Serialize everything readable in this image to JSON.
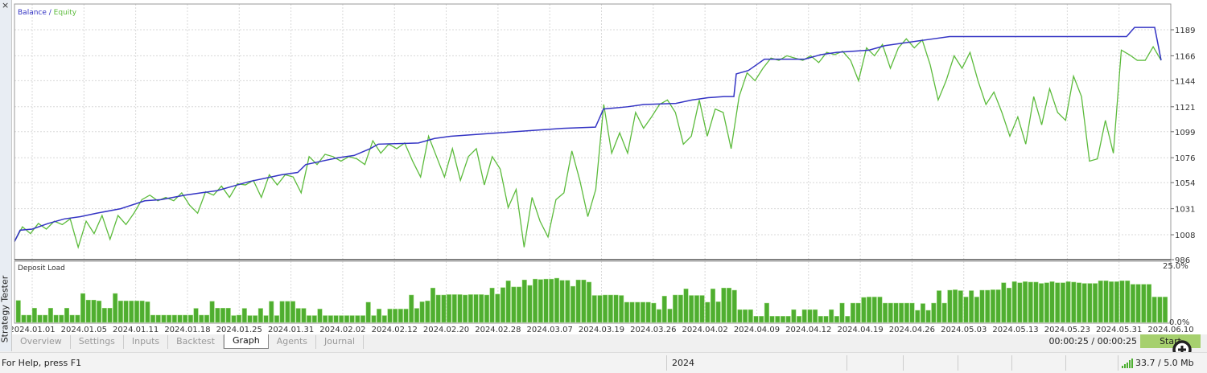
{
  "window": {
    "close_label": "×",
    "panel_title": "Strategy Tester"
  },
  "legend": {
    "balance": "Balance",
    "separator": " / ",
    "equity": "Equity"
  },
  "colors": {
    "balance": "#3434c4",
    "equity": "#5cbb3c",
    "bars": "#4fae30",
    "grid": "#d8d8d8"
  },
  "chart_data": [
    {
      "type": "line",
      "title": "Balance / Equity",
      "x_unit": "time index",
      "xlim": [
        0,
        142.5
      ],
      "ylim": [
        986,
        1200
      ],
      "y_ticks": [
        "1189",
        "1166",
        "1144",
        "1121",
        "1099",
        "1076",
        "1054",
        "1031",
        "1008",
        "986"
      ],
      "y_tick_values": [
        1189,
        1166,
        1144,
        1121,
        1099,
        1076,
        1054,
        1031,
        1008,
        986
      ],
      "grid": true,
      "series": [
        {
          "name": "Balance",
          "points": [
            [
              0,
              1002
            ],
            [
              0.7,
              1012
            ],
            [
              2.2,
              1013
            ],
            [
              4.2,
              1018
            ],
            [
              6.2,
              1022
            ],
            [
              8.2,
              1024
            ],
            [
              10.2,
              1027
            ],
            [
              13.2,
              1031
            ],
            [
              16.2,
              1038
            ],
            [
              18.2,
              1039
            ],
            [
              21.2,
              1043
            ],
            [
              23.2,
              1045
            ],
            [
              25.2,
              1047
            ],
            [
              27.2,
              1051
            ],
            [
              29.2,
              1055
            ],
            [
              31.2,
              1058
            ],
            [
              33.2,
              1061
            ],
            [
              35.2,
              1063
            ],
            [
              36.2,
              1070
            ],
            [
              38.2,
              1073
            ],
            [
              40.2,
              1076
            ],
            [
              42.2,
              1078
            ],
            [
              44.2,
              1084
            ],
            [
              45.2,
              1088
            ],
            [
              50.2,
              1089
            ],
            [
              52.2,
              1093
            ],
            [
              54.2,
              1095
            ],
            [
              68.2,
              1102
            ],
            [
              72.2,
              1103
            ],
            [
              73.2,
              1119
            ],
            [
              76.2,
              1121
            ],
            [
              78.2,
              1123
            ],
            [
              82.2,
              1124
            ],
            [
              84.2,
              1127
            ],
            [
              86.2,
              1129
            ],
            [
              88.2,
              1130
            ],
            [
              89.4,
              1130
            ],
            [
              89.7,
              1150
            ],
            [
              91.2,
              1153
            ],
            [
              92.2,
              1158
            ],
            [
              93.2,
              1163
            ],
            [
              98.2,
              1163
            ],
            [
              100.2,
              1167
            ],
            [
              102.2,
              1169
            ],
            [
              106.2,
              1171
            ],
            [
              108.2,
              1175
            ],
            [
              113.2,
              1180
            ],
            [
              116.2,
              1183
            ],
            [
              138.2,
              1183
            ],
            [
              139.2,
              1191
            ],
            [
              141.7,
              1191
            ],
            [
              142.5,
              1162
            ]
          ]
        },
        {
          "name": "Equity",
          "values": [
            1002,
            1015,
            1009,
            1018,
            1013,
            1020,
            1017,
            1022,
            997,
            1020,
            1009,
            1025,
            1004,
            1025,
            1017,
            1027,
            1039,
            1043,
            1038,
            1041,
            1038,
            1045,
            1034,
            1027,
            1046,
            1043,
            1051,
            1041,
            1053,
            1052,
            1056,
            1041,
            1061,
            1052,
            1061,
            1059,
            1045,
            1077,
            1070,
            1079,
            1077,
            1073,
            1077,
            1075,
            1070,
            1091,
            1080,
            1088,
            1084,
            1089,
            1073,
            1059,
            1095,
            1077,
            1059,
            1084,
            1056,
            1077,
            1084,
            1052,
            1077,
            1066,
            1032,
            1048,
            997,
            1041,
            1020,
            1006,
            1039,
            1045,
            1082,
            1056,
            1024,
            1048,
            1123,
            1080,
            1098,
            1080,
            1116,
            1102,
            1112,
            1123,
            1127,
            1116,
            1088,
            1095,
            1127,
            1095,
            1119,
            1116,
            1084,
            1130,
            1151,
            1144,
            1155,
            1164,
            1162,
            1166,
            1164,
            1162,
            1166,
            1160,
            1169,
            1167,
            1170,
            1162,
            1144,
            1173,
            1166,
            1176,
            1155,
            1173,
            1181,
            1173,
            1180,
            1158,
            1127,
            1144,
            1166,
            1155,
            1169,
            1144,
            1123,
            1134,
            1116,
            1095,
            1112,
            1088,
            1130,
            1105,
            1137,
            1116,
            1109,
            1148,
            1130,
            1073,
            1075,
            1109,
            1080,
            1171,
            1167,
            1162,
            1162,
            1174,
            1162
          ]
        }
      ]
    },
    {
      "type": "bar",
      "title": "Deposit Load",
      "ylim": [
        0,
        25
      ],
      "y_ticks": [
        "25.0%",
        "0.0%"
      ],
      "x_ticks": [
        "2024.01.01",
        "2024.01.05",
        "2024.01.11",
        "2024.01.18",
        "2024.01.25",
        "2024.01.31",
        "2024.02.02",
        "2024.02.12",
        "2024.02.20",
        "2024.02.28",
        "2024.03.07",
        "2024.03.19",
        "2024.03.26",
        "2024.04.02",
        "2024.04.09",
        "2024.04.12",
        "2024.04.19",
        "2024.04.26",
        "2024.05.03",
        "2024.05.13",
        "2024.05.23",
        "2024.05.31",
        "2024.06.10"
      ],
      "values": [
        10.0,
        3.3,
        3.3,
        6.5,
        3.3,
        3.3,
        6.5,
        3.3,
        3.3,
        6.5,
        3.3,
        3.3,
        13.2,
        10.2,
        10.2,
        9.8,
        6.5,
        6.5,
        13.2,
        9.8,
        9.8,
        9.8,
        9.8,
        9.8,
        9.4,
        3.3,
        3.3,
        3.3,
        3.3,
        3.3,
        3.3,
        3.3,
        3.3,
        6.4,
        3.3,
        3.3,
        9.6,
        6.5,
        6.5,
        6.5,
        3.1,
        3.3,
        6.4,
        3.1,
        3.1,
        6.4,
        3.1,
        9.6,
        3.1,
        9.6,
        9.6,
        9.6,
        6.4,
        6.4,
        3.1,
        3.1,
        6.1,
        3.1,
        3.1,
        3.1,
        3.1,
        3.1,
        3.1,
        3.1,
        3.1,
        9.2,
        3.1,
        6.1,
        3.1,
        6.1,
        6.1,
        6.1,
        6.1,
        12.5,
        6.4,
        9.4,
        9.8,
        15.7,
        12.5,
        12.5,
        12.7,
        12.7,
        12.7,
        12.5,
        12.7,
        12.7,
        12.7,
        12.5,
        15.7,
        12.9,
        15.9,
        19.0,
        16.2,
        16.2,
        19.4,
        16.9,
        19.8,
        19.6,
        19.8,
        19.8,
        20.2,
        19.2,
        19.2,
        16.5,
        19.4,
        19.4,
        18.4,
        12.3,
        12.3,
        12.5,
        12.5,
        12.5,
        12.3,
        9.2,
        9.2,
        9.2,
        9.2,
        9.2,
        8.8,
        5.9,
        12.0,
        6.1,
        12.5,
        12.5,
        15.3,
        12.3,
        12.3,
        12.3,
        9.2,
        15.3,
        9.4,
        15.7,
        15.7,
        14.7,
        5.8,
        5.8,
        5.8,
        2.8,
        2.8,
        8.8,
        2.8,
        2.8,
        2.8,
        2.8,
        5.8,
        2.8,
        5.8,
        5.8,
        5.8,
        2.8,
        2.8,
        5.8,
        2.8,
        8.8,
        2.8,
        8.8,
        8.8,
        11.4,
        11.6,
        11.6,
        11.6,
        8.8,
        8.8,
        8.8,
        8.8,
        8.8,
        8.8,
        5.5,
        8.6,
        5.5,
        8.8,
        14.5,
        8.8,
        14.7,
        14.9,
        14.5,
        11.6,
        14.5,
        11.6,
        14.7,
        14.7,
        14.9,
        14.9,
        18.1,
        15.7,
        18.6,
        18.1,
        18.6,
        18.4,
        18.4,
        17.8,
        18.1,
        18.6,
        18.1,
        18.1,
        18.6,
        18.4,
        18.1,
        17.8,
        17.8,
        17.8,
        19.0,
        19.0,
        18.6,
        18.6,
        19.0,
        19.0,
        17.4,
        17.4,
        17.4,
        17.4,
        11.6,
        11.6,
        11.6
      ]
    }
  ],
  "tabs": [
    "Overview",
    "Settings",
    "Inputs",
    "Backtest",
    "Graph",
    "Agents",
    "Journal"
  ],
  "active_tab": "Graph",
  "timer": "00:00:25 / 00:00:25",
  "start_button": "Start",
  "status": {
    "help": "For Help, press F1",
    "year": "2024",
    "memory": "33.7 / 5.0 Mb"
  }
}
